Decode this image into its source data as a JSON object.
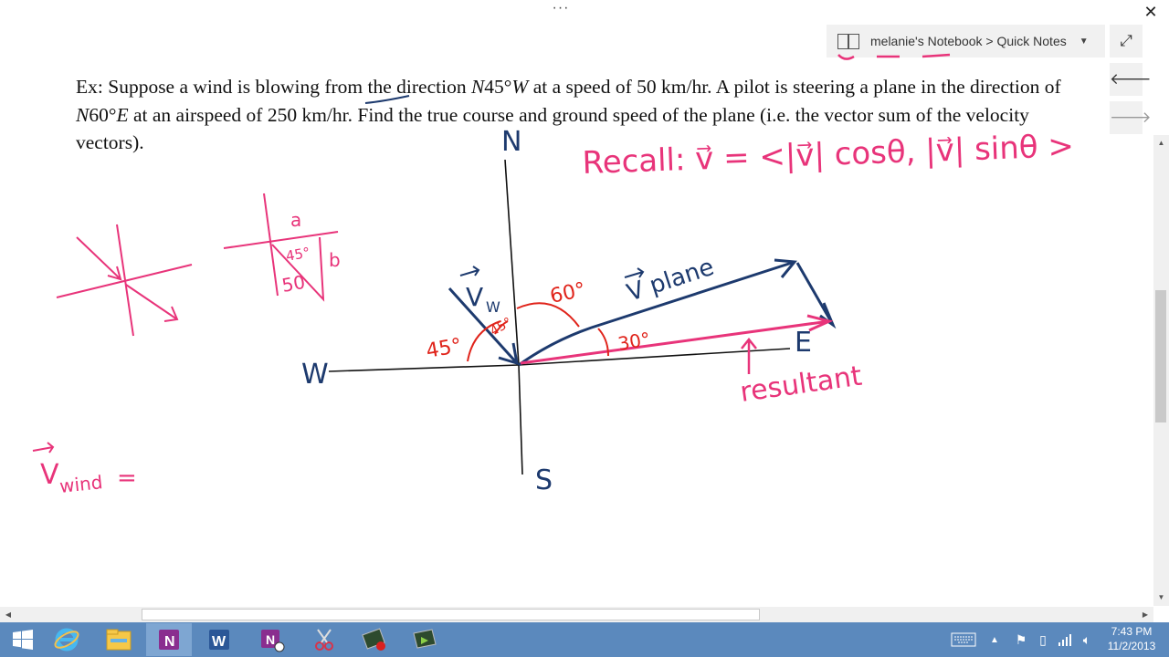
{
  "window": {
    "more_label": "···",
    "close_label": "✕"
  },
  "navigation": {
    "breadcrumb": "melanie's Notebook > Quick Notes",
    "dropdown_icon": "chevron-down-icon",
    "expand_icon": "expand-icon",
    "back_icon": "back-arrow-icon",
    "forward_icon": "forward-arrow-icon"
  },
  "note": {
    "problem_text": {
      "prefix": "Ex: Suppose a wind is blowing ",
      "from": "from",
      "dir1_pre": " the direction ",
      "dir1": "N",
      "dir1_deg": "45°",
      "dir1_end": "W",
      "mid1": " at a speed of 50 km/hr.  A pilot is steering a plane in the direction of ",
      "dir2": "N",
      "dir2_deg": "60°",
      "dir2_end": "E",
      "mid2": " at an airspeed of 250 km/hr. Find the true course and ground speed of the plane (i.e. the vector sum of the velocity vectors)."
    },
    "handwriting": {
      "recall": "Recall:  v⃗ = <|v⃗| cosθ, |v⃗| sinθ >",
      "compass_n": "N",
      "compass_s": "S",
      "compass_w": "W",
      "compass_e": "E",
      "v_w": "V",
      "v_w_sub": "W",
      "v_plane": "V plane",
      "resultant": "resultant",
      "angle_45_outer": "45°",
      "angle_45_inner": "45°",
      "angle_60": "60°",
      "angle_30": "30°",
      "tri_a": "a",
      "tri_b": "b",
      "tri_45": "45°",
      "tri_50": "50",
      "v_wind": "V",
      "v_wind_sub": "wind",
      "v_wind_eq": "="
    }
  },
  "taskbar": {
    "items": [
      {
        "name": "start-button",
        "icon": "windows-logo-icon"
      },
      {
        "name": "internet-explorer",
        "icon": "ie-icon"
      },
      {
        "name": "file-explorer",
        "icon": "folder-icon"
      },
      {
        "name": "onenote",
        "icon": "onenote-icon",
        "label": "N"
      },
      {
        "name": "word",
        "icon": "word-icon",
        "label": "W"
      },
      {
        "name": "onenote-clip",
        "icon": "onenote-clip-icon",
        "label": "N"
      },
      {
        "name": "snipping-tool",
        "icon": "scissors-icon"
      },
      {
        "name": "camtasia-recorder",
        "icon": "recorder-icon"
      },
      {
        "name": "camtasia",
        "icon": "camtasia-icon"
      }
    ],
    "tray_icons": [
      "keyboard-icon",
      "show-hidden-icon",
      "flag-icon",
      "power-icon",
      "network-icon",
      "volume-icon"
    ],
    "time": "7:43 PM",
    "date": "11/2/2013"
  },
  "colors": {
    "pink": "#e8347a",
    "navy": "#1d3a6e",
    "red": "#e0241b",
    "taskbar": "#5b89bd",
    "onenote": "#8a2e8f",
    "word": "#2b5797"
  }
}
